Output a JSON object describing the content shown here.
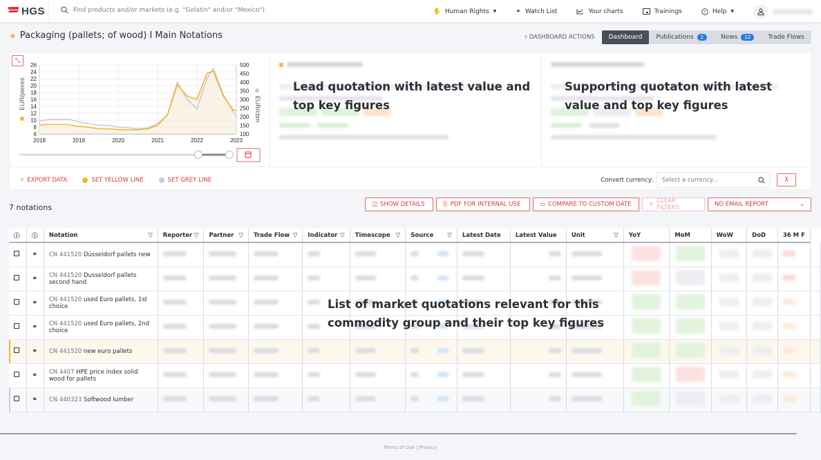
{
  "header": {
    "logo": "HGS",
    "search_placeholder": "Find products and/or markets (e.g. \"Gelatin\" and/or \"Mexico\")",
    "nav": [
      {
        "label": "Human Rights",
        "icon": "hand-icon",
        "dropdown": true
      },
      {
        "label": "Watch List",
        "icon": "binoculars-icon"
      },
      {
        "label": "Your charts",
        "icon": "line-chart-icon"
      },
      {
        "label": "Trainings",
        "icon": "presentation-icon"
      },
      {
        "label": "Help",
        "icon": "question-circle-icon",
        "dropdown": true
      }
    ]
  },
  "page": {
    "title": "Packaging (pallets; of wood) I Main Notations",
    "dashboard_actions": "DASHBOARD ACTIONS",
    "tabs": [
      {
        "label": "Dashboard",
        "active": true
      },
      {
        "label": "Publications",
        "badge": "2"
      },
      {
        "label": "News",
        "badge": "12"
      },
      {
        "label": "Trade Flows"
      }
    ]
  },
  "chart_data": {
    "type": "line",
    "x": [
      "2018-01",
      "2018-04",
      "2018-07",
      "2018-10",
      "2019-01",
      "2019-04",
      "2019-07",
      "2019-10",
      "2020-01",
      "2020-04",
      "2020-07",
      "2020-10",
      "2021-01",
      "2021-04",
      "2021-07",
      "2021-10",
      "2022-01",
      "2022-04",
      "2022-06",
      "2022-09",
      "2022-12",
      "2023-01"
    ],
    "series": [
      {
        "name": "EUR/pieces",
        "axis": "left",
        "color": "#f2b632",
        "values": [
          8.6,
          8.8,
          8.8,
          8.7,
          8.2,
          8.0,
          7.5,
          7.5,
          7.3,
          7.2,
          7.2,
          7.5,
          8.5,
          11.5,
          20.2,
          17.0,
          16.0,
          23.5,
          24.2,
          17.0,
          13.0,
          12.8
        ]
      },
      {
        "name": "EUR/cbm",
        "axis": "right",
        "color": "#c8ccd6",
        "values": [
          175,
          185,
          185,
          185,
          170,
          160,
          150,
          150,
          140,
          135,
          130,
          135,
          160,
          210,
          400,
          300,
          245,
          420,
          480,
          330,
          230,
          200
        ]
      }
    ],
    "x_ticks": [
      "2018",
      "2019",
      "2020",
      "2021",
      "2022",
      "2023"
    ],
    "y_left": {
      "label": "EUR/pieces",
      "ticks": [
        6,
        8,
        10,
        12,
        14,
        16,
        18,
        20,
        22,
        24,
        26
      ],
      "range": [
        6,
        26
      ]
    },
    "y_right": {
      "label": "EUR/cbm",
      "ticks": [
        100,
        150,
        200,
        250,
        300,
        350,
        400,
        450,
        500
      ],
      "range": [
        100,
        500
      ]
    },
    "grid": true,
    "area_fill": true
  },
  "lead_quote": {
    "overlay": "Lead quotation with latest value and top key figures"
  },
  "support_quote": {
    "overlay": "Supporting quotaton with latest value and top key figures"
  },
  "panel_actions": {
    "export": "EXPORT DATA",
    "yellow": "SET YELLOW LINE",
    "grey": "SET GREY LINE",
    "currency_label": "Convert currency:",
    "currency_placeholder": "Select a currency..."
  },
  "list": {
    "count": "7 notations",
    "buttons": {
      "details": "SHOW DETAILS",
      "pdf": "PDF FOR INTERNAL USE",
      "compare": "COMPARE TO CUSTOM DATE",
      "clear": "CLEAR FILTERS",
      "email": "NO EMAIL REPORT"
    },
    "columns": [
      "Notation",
      "Reporter",
      "Partner",
      "Trade Flow",
      "Indicator",
      "Timescope",
      "Source",
      "Latest Date",
      "Latest Value",
      "Unit",
      "YoY",
      "MoM",
      "WoW",
      "DoD",
      "36 M F"
    ],
    "rows": [
      {
        "code": "CN 441520",
        "name": "Düsseldorf pallets new",
        "yoy": "red",
        "mom": "green"
      },
      {
        "code": "CN 441520",
        "name": "Dusseldorf pallets second hand",
        "yoy": "red",
        "mom": "grey"
      },
      {
        "code": "CN 441520",
        "name": "used Euro pallets, 1st choice",
        "yoy": "green",
        "mom": "green"
      },
      {
        "code": "CN 441520",
        "name": "used Euro pallets, 2nd choice",
        "yoy": "green",
        "mom": "green"
      },
      {
        "code": "CN 441520",
        "name": "new euro pallets",
        "yoy": "green",
        "mom": "green",
        "highlight": "yellow"
      },
      {
        "code": "CN 4407",
        "name": "HPE price index solid wood for pallets",
        "yoy": "green",
        "mom": "red"
      },
      {
        "code": "CN 440323",
        "name": "Softwood lumber",
        "yoy": "green",
        "mom": "grey",
        "highlight": "grey"
      }
    ],
    "overlay": "List of market quotations relevant for this commodity group and their top key figures"
  },
  "footer": {
    "terms": "Terms of Use",
    "sep": "|",
    "privacy": "Privacy"
  }
}
